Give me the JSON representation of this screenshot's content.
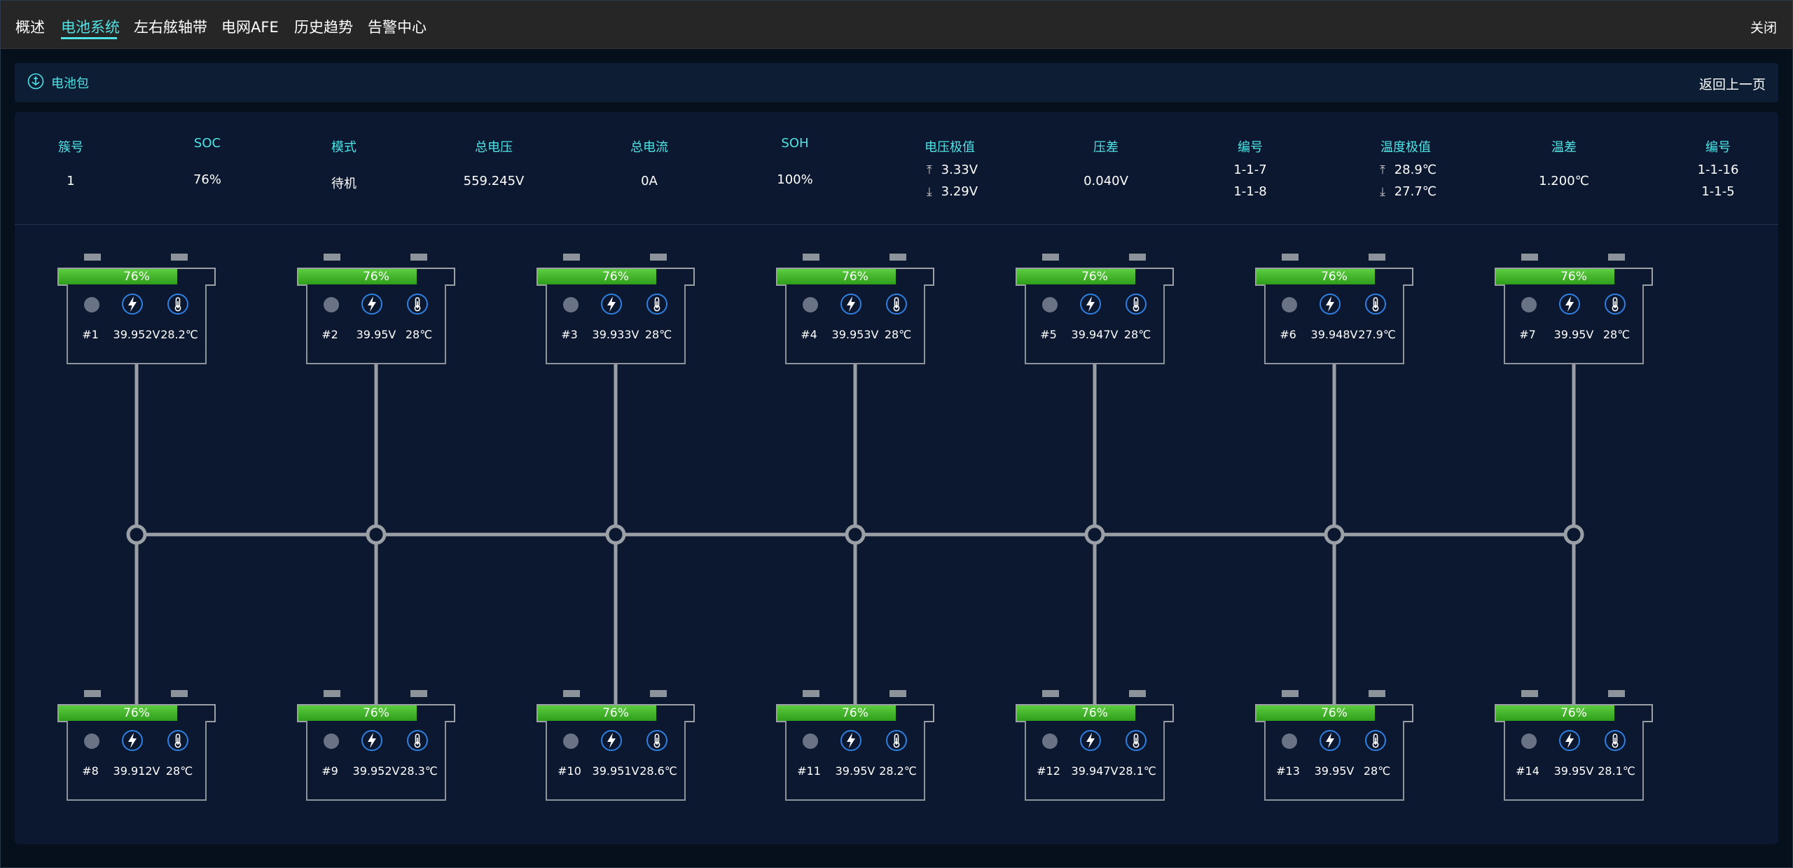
{
  "tabs": [
    {
      "label": "概述",
      "active": false
    },
    {
      "label": "电池系统",
      "active": true
    },
    {
      "label": "左右舷轴带",
      "active": false
    },
    {
      "label": "电网AFE",
      "active": false
    },
    {
      "label": "历史趋势",
      "active": false
    },
    {
      "label": "告警中心",
      "active": false
    }
  ],
  "close_label": "关闭",
  "subbar": {
    "title": "电池包",
    "back_label": "返回上一页"
  },
  "summary": {
    "cluster_no": {
      "label": "簇号",
      "value": "1"
    },
    "soc": {
      "label": "SOC",
      "value": "76%"
    },
    "mode": {
      "label": "模式",
      "value": "待机"
    },
    "total_voltage": {
      "label": "总电压",
      "value": "559.245V"
    },
    "total_current": {
      "label": "总电流",
      "value": "0A"
    },
    "soh": {
      "label": "SOH",
      "value": "100%"
    },
    "voltage_extreme": {
      "label": "电压极值",
      "max": "3.33V",
      "min": "3.29V"
    },
    "voltage_diff": {
      "label": "压差",
      "value": "0.040V"
    },
    "voltage_id": {
      "label": "编号",
      "max": "1-1-7",
      "min": "1-1-8"
    },
    "temp_extreme": {
      "label": "温度极值",
      "max": "28.9℃",
      "min": "27.7℃"
    },
    "temp_diff": {
      "label": "温差",
      "value": "1.200℃"
    },
    "temp_id": {
      "label": "编号",
      "max": "1-1-16",
      "min": "1-1-5"
    }
  },
  "batteries": [
    {
      "id": "#1",
      "soc": 76,
      "soc_text": "76%",
      "voltage": "39.952V",
      "temp": "28.2℃"
    },
    {
      "id": "#2",
      "soc": 76,
      "soc_text": "76%",
      "voltage": "39.95V",
      "temp": "28℃"
    },
    {
      "id": "#3",
      "soc": 76,
      "soc_text": "76%",
      "voltage": "39.933V",
      "temp": "28℃"
    },
    {
      "id": "#4",
      "soc": 76,
      "soc_text": "76%",
      "voltage": "39.953V",
      "temp": "28℃"
    },
    {
      "id": "#5",
      "soc": 76,
      "soc_text": "76%",
      "voltage": "39.947V",
      "temp": "28℃"
    },
    {
      "id": "#6",
      "soc": 76,
      "soc_text": "76%",
      "voltage": "39.948V",
      "temp": "27.9℃"
    },
    {
      "id": "#7",
      "soc": 76,
      "soc_text": "76%",
      "voltage": "39.95V",
      "temp": "28℃"
    },
    {
      "id": "#8",
      "soc": 76,
      "soc_text": "76%",
      "voltage": "39.912V",
      "temp": "28℃"
    },
    {
      "id": "#9",
      "soc": 76,
      "soc_text": "76%",
      "voltage": "39.952V",
      "temp": "28.3℃"
    },
    {
      "id": "#10",
      "soc": 76,
      "soc_text": "76%",
      "voltage": "39.951V",
      "temp": "28.6℃"
    },
    {
      "id": "#11",
      "soc": 76,
      "soc_text": "76%",
      "voltage": "39.95V",
      "temp": "28.2℃"
    },
    {
      "id": "#12",
      "soc": 76,
      "soc_text": "76%",
      "voltage": "39.947V",
      "temp": "28.1℃"
    },
    {
      "id": "#13",
      "soc": 76,
      "soc_text": "76%",
      "voltage": "39.95V",
      "temp": "28℃"
    },
    {
      "id": "#14",
      "soc": 76,
      "soc_text": "76%",
      "voltage": "39.95V",
      "temp": "28.1℃"
    }
  ],
  "icons": {
    "status": "status-dot-icon",
    "voltage": "lightning-icon",
    "temperature": "thermometer-icon",
    "pack": "anchor-icon"
  },
  "colors": {
    "accent": "#4fe3e6",
    "soc_fill": "#4cbf2f",
    "wire": "#9aa0a6",
    "icon": "#2f7fe0"
  }
}
